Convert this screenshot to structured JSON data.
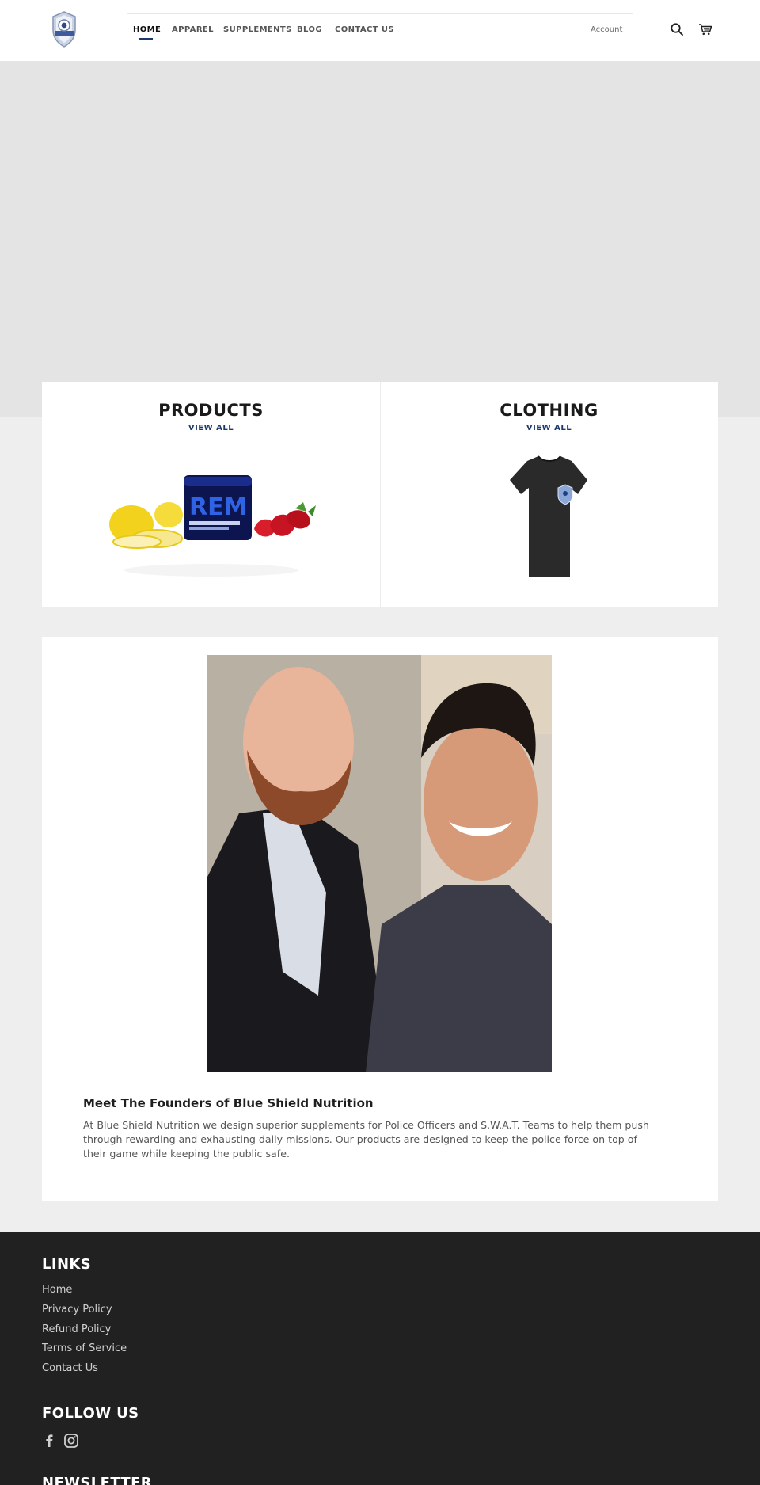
{
  "header": {
    "nav": [
      {
        "label": "HOME",
        "active": true
      },
      {
        "label": "APPAREL",
        "active": false
      },
      {
        "label": "SUPPLEMENTS",
        "active": false
      },
      {
        "label": "BLOG",
        "active": false
      },
      {
        "label": "CONTACT US",
        "active": false
      }
    ],
    "account_label": "Account",
    "icons": [
      "search-icon",
      "cart-icon"
    ]
  },
  "collections": [
    {
      "title": "PRODUCTS",
      "link": "VIEW ALL",
      "image": "supplement-tub-with-lemons-and-strawberries"
    },
    {
      "title": "CLOTHING",
      "link": "VIEW ALL",
      "image": "black-tshirt-with-badge"
    }
  ],
  "founders": {
    "heading": "Meet The Founders of Blue Shield Nutrition",
    "text": "At Blue Shield Nutrition we design superior supplements for Police Officers and S.W.A.T. Teams to help them push through rewarding and exhausting daily missions. Our products are designed to keep the police force on top of their game while keeping the public safe."
  },
  "footer": {
    "links_heading": "LINKS",
    "links": [
      "Home",
      "Privacy Policy",
      "Refund Policy",
      "Terms of Service",
      "Contact Us"
    ],
    "follow_heading": "FOLLOW US",
    "social": [
      "facebook-icon",
      "instagram-icon"
    ],
    "newsletter_heading": "NEWSLETTER"
  },
  "colors": {
    "accent": "#1b3a6b",
    "footer_bg": "#212121",
    "hero_bg": "#e4e4e4",
    "page_bg": "#eeeeee"
  }
}
